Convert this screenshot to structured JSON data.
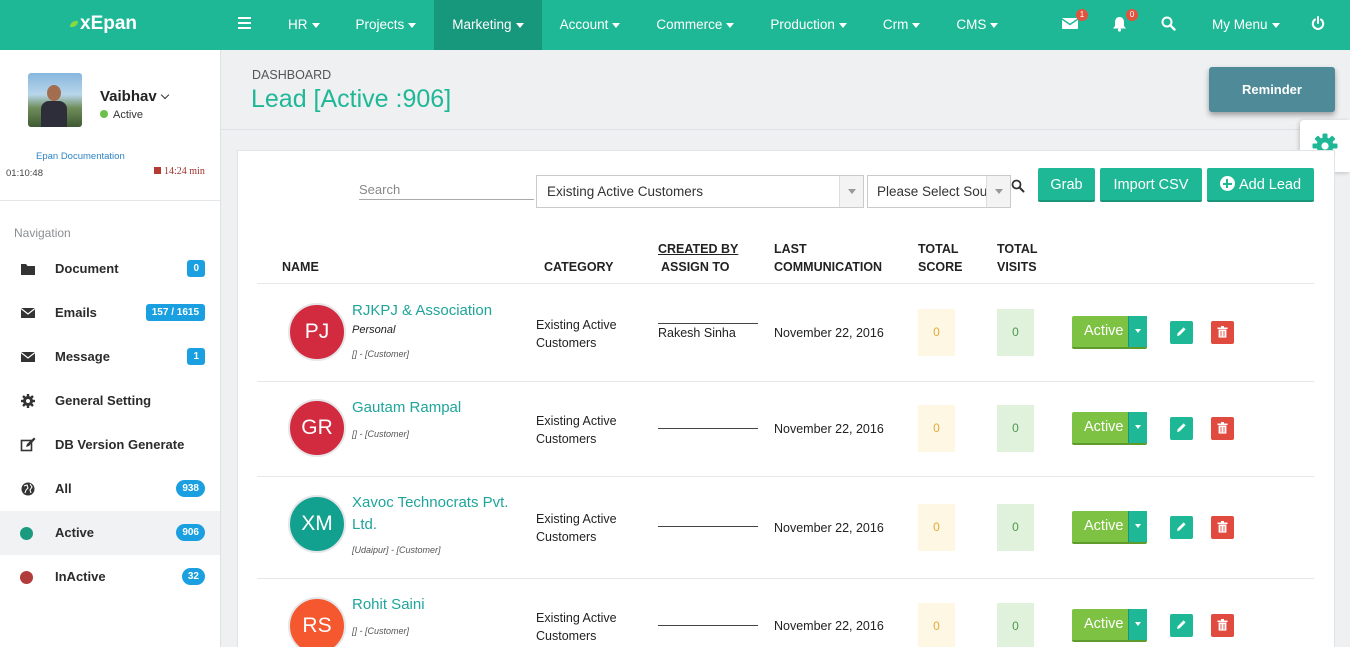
{
  "app": {
    "logo": "xEpan"
  },
  "topnav": {
    "items": [
      {
        "label": "HR"
      },
      {
        "label": "Projects"
      },
      {
        "label": "Marketing",
        "active": true
      },
      {
        "label": "Account"
      },
      {
        "label": "Commerce"
      },
      {
        "label": "Production"
      },
      {
        "label": "Crm"
      },
      {
        "label": "CMS"
      }
    ],
    "mail_count": "1",
    "notification_count": "0",
    "my_menu": "My Menu"
  },
  "user": {
    "name": "Vaibhav",
    "status": "Active",
    "doc_link": "Epan Documentation",
    "clock": "01:10:48",
    "timer": "14:24 min"
  },
  "sidebar": {
    "heading": "Navigation",
    "items": [
      {
        "label": "Document",
        "count": "0",
        "icon": "folder-icon"
      },
      {
        "label": "Emails",
        "count": "157 / 1615",
        "icon": "envelope-icon"
      },
      {
        "label": "Message",
        "count": "1",
        "icon": "envelope-icon"
      },
      {
        "label": "General Setting",
        "icon": "gear-icon"
      },
      {
        "label": "DB Version Generate",
        "icon": "edit-icon"
      },
      {
        "label": "All",
        "count": "938",
        "icon": "globe-icon"
      },
      {
        "label": "Active",
        "count": "906",
        "icon": "dot-icon",
        "color": "#1a9b7f"
      },
      {
        "label": "InActive",
        "count": "32",
        "icon": "dot-icon",
        "color": "#b13c3c"
      }
    ]
  },
  "page": {
    "breadcrumb": "DASHBOARD",
    "title": "Lead [Active :906]",
    "reminder_button": "Reminder"
  },
  "filters": {
    "search_placeholder": "Search",
    "category_value": "Existing Active Customers",
    "source_value": "Please Select Sou..."
  },
  "actions": {
    "grab": "Grab",
    "import_csv": "Import CSV",
    "add_lead": "Add Lead"
  },
  "table": {
    "headers": {
      "name": "NAME",
      "category": "CATEGORY",
      "created_by": "CREATED BY",
      "assign_to": "ASSIGN TO",
      "last": "LAST",
      "communication": "COMMUNICATION",
      "total_score_1": "TOTAL",
      "total_score_2": "SCORE",
      "total_visits_1": "TOTAL",
      "total_visits_2": "VISITS"
    },
    "rows": [
      {
        "initials": "PJ",
        "avatar_color": "#d22a3e",
        "name": "RJKPJ & Association",
        "type": "Personal",
        "meta": "[] - [Customer]",
        "category": "Existing Active Customers",
        "assign_to": "Rakesh Sinha",
        "last_comm": "November 22, 2016",
        "score": "0",
        "visits": "0",
        "status": "Active"
      },
      {
        "initials": "GR",
        "avatar_color": "#d22a3e",
        "name": "Gautam Rampal",
        "type": "",
        "meta": "[] - [Customer]",
        "category": "Existing Active Customers",
        "assign_to": "",
        "last_comm": "November 22, 2016",
        "score": "0",
        "visits": "0",
        "status": "Active"
      },
      {
        "initials": "XM",
        "avatar_color": "#12a08f",
        "name": "Xavoc Technocrats Pvt. Ltd.",
        "type": "",
        "meta": "[Udaipur] - [Customer]",
        "category": "Existing Active Customers",
        "assign_to": "",
        "last_comm": "November 22, 2016",
        "score": "0",
        "visits": "0",
        "status": "Active"
      },
      {
        "initials": "RS",
        "avatar_color": "#f5572e",
        "name": "Rohit Saini",
        "type": "",
        "meta": "[] - [Customer]",
        "category": "Existing Active Customers",
        "assign_to": "",
        "last_comm": "November 22, 2016",
        "score": "0",
        "visits": "0",
        "status": "Active"
      }
    ]
  },
  "colors": {
    "accent": "#1fb896",
    "active_button": "#7dc242",
    "delete": "#e04a3f",
    "badge": "#1a9fe0"
  }
}
